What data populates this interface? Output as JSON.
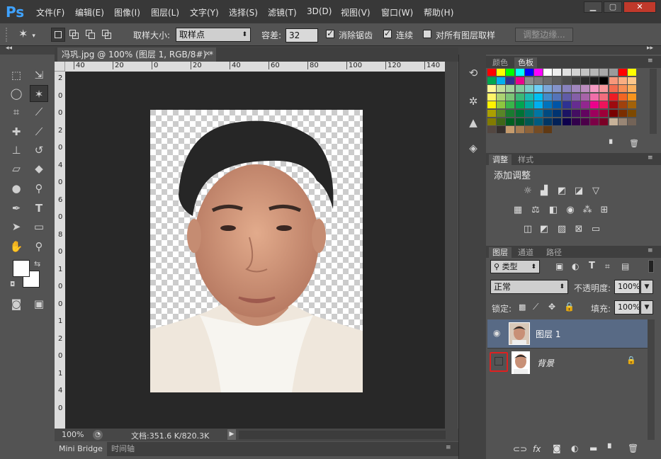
{
  "app": {
    "logo": "Ps"
  },
  "menu": [
    "文件(F)",
    "编辑(E)",
    "图像(I)",
    "图层(L)",
    "文字(Y)",
    "选择(S)",
    "滤镜(T)",
    "3D(D)",
    "视图(V)",
    "窗口(W)",
    "帮助(H)"
  ],
  "window_buttons": {
    "minimize": "▁",
    "restore": "▢",
    "close": "✕"
  },
  "options": {
    "sample_size_label": "取样大小:",
    "sample_size_value": "取样点",
    "tolerance_label": "容差:",
    "tolerance_value": "32",
    "anti_alias_label": "消除锯齿",
    "anti_alias_checked": true,
    "contiguous_label": "连续",
    "contiguous_checked": true,
    "all_layers_label": "对所有图层取样",
    "all_layers_checked": false,
    "refine_edge_label": "调整边缘..."
  },
  "document": {
    "tab_title": "冯巩.jpg @ 100% (图层 1, RGB/8#) *",
    "ruler_top": [
      "40",
      "20",
      "0",
      "20",
      "40",
      "60",
      "80",
      "100",
      "120",
      "140"
    ],
    "ruler_left": [
      "2",
      "0",
      "0",
      "2",
      "0",
      "4",
      "0",
      "6",
      "0",
      "8",
      "0",
      "1",
      "0",
      "0",
      "1",
      "2",
      "0",
      "1",
      "4",
      "0"
    ],
    "zoom": "100%",
    "doc_size": "文档:351.6 K/820.3K"
  },
  "bottom_tabs": [
    "Mini Bridge",
    "时间轴"
  ],
  "color_panel": {
    "tabs": [
      "颜色",
      "色板"
    ],
    "active": 1
  },
  "swatches": [
    [
      "#ff0000",
      "#ffff00",
      "#00ff00",
      "#00ffff",
      "#0000ff",
      "#ff00ff",
      "#ffffff",
      "#eeeeee",
      "#e0e0e0",
      "#d2d2d2",
      "#c4c4c4",
      "#b6b6b6",
      "#a8a8a8",
      "#9a9a9a",
      "#ff0000",
      "#ffff00"
    ],
    [
      "#00a650",
      "#00aeef",
      "#2e3192",
      "#ec008c",
      "#8c8c8c",
      "#7c7c7c",
      "#6c6c6c",
      "#5c5c5c",
      "#4c4c4c",
      "#3c3c3c",
      "#2c2c2c",
      "#1c1c1c",
      "#000000",
      "#f7977a",
      "#f9ad81",
      "#fdc68a"
    ],
    [
      "#fff79a",
      "#c4df9b",
      "#a2d39c",
      "#82ca9d",
      "#7bcdc8",
      "#6ecff6",
      "#7ea7d8",
      "#8493ca",
      "#8882be",
      "#a187be",
      "#bc8dbf",
      "#f49ac2",
      "#f6989d",
      "#f26c4f",
      "#f68e55",
      "#fbaf5c"
    ],
    [
      "#fff467",
      "#acd372",
      "#7cc576",
      "#3bb878",
      "#1abbb4",
      "#00bff3",
      "#438ccb",
      "#5574b9",
      "#605ca8",
      "#855fa8",
      "#a763a8",
      "#f06ea9",
      "#f26d7d",
      "#ed1c24",
      "#f26522",
      "#f7941d"
    ],
    [
      "#fff200",
      "#8dc63f",
      "#39b54a",
      "#00a651",
      "#00a99d",
      "#00aeef",
      "#0072bc",
      "#0054a6",
      "#2e3192",
      "#662d91",
      "#92278f",
      "#ec008c",
      "#ed145b",
      "#9e0b0f",
      "#a0410d",
      "#a36209"
    ],
    [
      "#aba000",
      "#598527",
      "#197b30",
      "#007236",
      "#00746b",
      "#0076a3",
      "#004a80",
      "#003471",
      "#1b1464",
      "#440e62",
      "#630460",
      "#9e005d",
      "#9e0039",
      "#790000",
      "#7b2e00",
      "#7d4900"
    ],
    [
      "#827b00",
      "#406618",
      "#005e20",
      "#005826",
      "#005952",
      "#005b7f",
      "#003663",
      "#002157",
      "#0d004c",
      "#32004b",
      "#4b0049",
      "#7b0046",
      "#7a0026",
      "#c7b299",
      "#998675",
      "#736357"
    ],
    [
      "#534741",
      "#37302d",
      "#c69c6d",
      "#a67c52",
      "#8c6239",
      "#754c24",
      "#603913"
    ]
  ],
  "adjust_panel": {
    "tabs": [
      "调整",
      "样式"
    ],
    "heading": "添加调整"
  },
  "layers_panel": {
    "tabs": [
      "图层",
      "通道",
      "路径"
    ],
    "filter_kind": "类型",
    "blend_mode": "正常",
    "opacity_label": "不透明度:",
    "opacity_value": "100%",
    "lock_label": "锁定:",
    "fill_label": "填充:",
    "fill_value": "100%",
    "layers": [
      {
        "name": "图层 1",
        "visible": true,
        "selected": true
      },
      {
        "name": "背景",
        "visible": false,
        "selected": false,
        "locked": true
      }
    ]
  },
  "colors": {
    "accent": "#3fa2ff",
    "selected_layer": "#586a85",
    "highlight_box": "#e02020"
  }
}
